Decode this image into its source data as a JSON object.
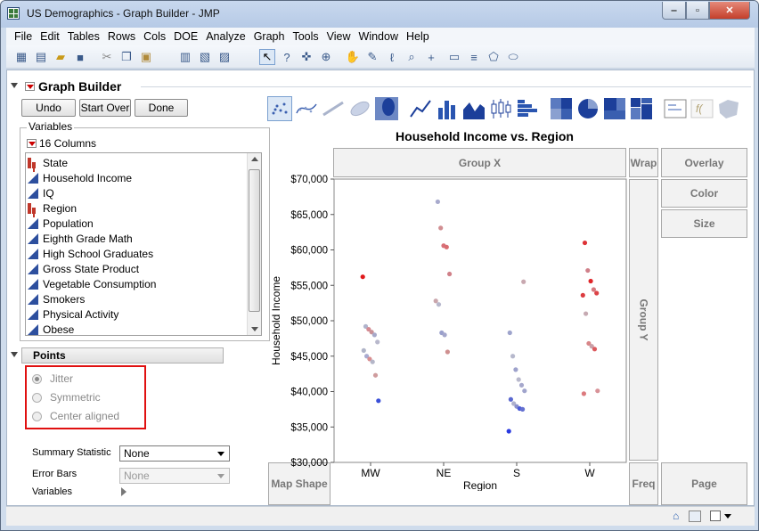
{
  "window": {
    "title": "US Demographics - Graph Builder - JMP"
  },
  "menu": [
    "File",
    "Edit",
    "Tables",
    "Rows",
    "Cols",
    "DOE",
    "Analyze",
    "Graph",
    "Tools",
    "View",
    "Window",
    "Help"
  ],
  "panel": {
    "title": "Graph Builder",
    "buttons": {
      "undo": "Undo",
      "start_over": "Start Over",
      "done": "Done"
    },
    "variables_label": "Variables",
    "columns_header": "16 Columns",
    "columns": [
      {
        "name": "State",
        "type": "nominal"
      },
      {
        "name": "Household Income",
        "type": "continuous"
      },
      {
        "name": "IQ",
        "type": "continuous"
      },
      {
        "name": "Region",
        "type": "nominal"
      },
      {
        "name": "Population",
        "type": "continuous"
      },
      {
        "name": "Eighth Grade Math",
        "type": "continuous"
      },
      {
        "name": "High School Graduates",
        "type": "continuous"
      },
      {
        "name": "Gross State Product",
        "type": "continuous"
      },
      {
        "name": "Vegetable Consumption",
        "type": "continuous"
      },
      {
        "name": "Smokers",
        "type": "continuous"
      },
      {
        "name": "Physical Activity",
        "type": "continuous"
      },
      {
        "name": "Obese",
        "type": "continuous"
      }
    ],
    "points_header": "Points",
    "points_options": [
      "Jitter",
      "Symmetric",
      "Center aligned"
    ],
    "points_selected": "Jitter",
    "summary_statistic_label": "Summary Statistic",
    "summary_statistic_value": "None",
    "error_bars_label": "Error Bars",
    "error_bars_value": "None",
    "variables_row_label": "Variables"
  },
  "zones": {
    "group_x": "Group X",
    "wrap": "Wrap",
    "overlay": "Overlay",
    "color": "Color",
    "size": "Size",
    "group_y": "Group Y",
    "map_shape": "Map Shape",
    "freq": "Freq",
    "page": "Page"
  },
  "chart_data": {
    "type": "scatter",
    "title": "Household Income vs. Region",
    "xlabel": "Region",
    "ylabel": "Household Income",
    "categories": [
      "MW",
      "NE",
      "S",
      "W"
    ],
    "yticks": [
      "$30,000",
      "$35,000",
      "$40,000",
      "$45,000",
      "$50,000",
      "$55,000",
      "$60,000",
      "$65,000",
      "$70,000"
    ],
    "ylim": [
      30000,
      70000
    ],
    "points": [
      {
        "cat": "MW",
        "y": 56200,
        "color": "#e0191b"
      },
      {
        "cat": "MW",
        "y": 49200,
        "color": "#b0b4cc"
      },
      {
        "cat": "MW",
        "y": 48800,
        "color": "#d58a92"
      },
      {
        "cat": "MW",
        "y": 48400,
        "color": "#c89096"
      },
      {
        "cat": "MW",
        "y": 48000,
        "color": "#a7a9c9"
      },
      {
        "cat": "MW",
        "y": 47000,
        "color": "#b8b8cc"
      },
      {
        "cat": "MW",
        "y": 45800,
        "color": "#b0b4c8"
      },
      {
        "cat": "MW",
        "y": 45000,
        "color": "#a8aad0"
      },
      {
        "cat": "MW",
        "y": 44600,
        "color": "#d88e90"
      },
      {
        "cat": "MW",
        "y": 44200,
        "color": "#b4b6c8"
      },
      {
        "cat": "MW",
        "y": 42300,
        "color": "#cf9c9e"
      },
      {
        "cat": "MW",
        "y": 38700,
        "color": "#3a4fd8"
      },
      {
        "cat": "NE",
        "y": 66800,
        "color": "#a8aacd"
      },
      {
        "cat": "NE",
        "y": 63100,
        "color": "#d18e92"
      },
      {
        "cat": "NE",
        "y": 60600,
        "color": "#d87078"
      },
      {
        "cat": "NE",
        "y": 60400,
        "color": "#d86c70"
      },
      {
        "cat": "NE",
        "y": 56600,
        "color": "#d08088"
      },
      {
        "cat": "NE",
        "y": 52800,
        "color": "#caa6ac"
      },
      {
        "cat": "NE",
        "y": 52300,
        "color": "#b7b8cc"
      },
      {
        "cat": "NE",
        "y": 48300,
        "color": "#9aa0cc"
      },
      {
        "cat": "NE",
        "y": 48000,
        "color": "#a4a7cc"
      },
      {
        "cat": "NE",
        "y": 45600,
        "color": "#cf9090"
      },
      {
        "cat": "S",
        "y": 55500,
        "color": "#c8a8b0"
      },
      {
        "cat": "S",
        "y": 48300,
        "color": "#9ea4cc"
      },
      {
        "cat": "S",
        "y": 45000,
        "color": "#b6b8cc"
      },
      {
        "cat": "S",
        "y": 43100,
        "color": "#9ea2cc"
      },
      {
        "cat": "S",
        "y": 41700,
        "color": "#b8b8cc"
      },
      {
        "cat": "S",
        "y": 40900,
        "color": "#a6a8cc"
      },
      {
        "cat": "S",
        "y": 40100,
        "color": "#a0a4cc"
      },
      {
        "cat": "S",
        "y": 38900,
        "color": "#5a68d0"
      },
      {
        "cat": "S",
        "y": 38300,
        "color": "#aeb0cc"
      },
      {
        "cat": "S",
        "y": 37900,
        "color": "#8a90cc"
      },
      {
        "cat": "S",
        "y": 37600,
        "color": "#4a5ad8"
      },
      {
        "cat": "S",
        "y": 37500,
        "color": "#6470d0"
      },
      {
        "cat": "S",
        "y": 34400,
        "color": "#2a3ae0"
      },
      {
        "cat": "W",
        "y": 61000,
        "color": "#dd3236"
      },
      {
        "cat": "W",
        "y": 57100,
        "color": "#d0808a"
      },
      {
        "cat": "W",
        "y": 55600,
        "color": "#e0262a"
      },
      {
        "cat": "W",
        "y": 54400,
        "color": "#d6787e"
      },
      {
        "cat": "W",
        "y": 53900,
        "color": "#dc4448"
      },
      {
        "cat": "W",
        "y": 53600,
        "color": "#dc3c40"
      },
      {
        "cat": "W",
        "y": 51000,
        "color": "#c6aab2"
      },
      {
        "cat": "W",
        "y": 46800,
        "color": "#d88688"
      },
      {
        "cat": "W",
        "y": 46400,
        "color": "#c8a0a8"
      },
      {
        "cat": "W",
        "y": 46000,
        "color": "#dc5a5e"
      },
      {
        "cat": "W",
        "y": 40100,
        "color": "#d89298"
      },
      {
        "cat": "W",
        "y": 39700,
        "color": "#dc7a7e"
      }
    ]
  }
}
